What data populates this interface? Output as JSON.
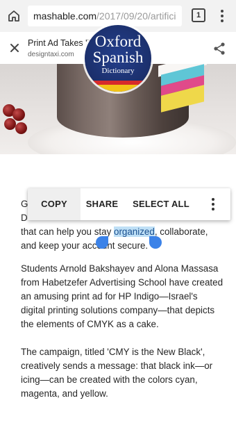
{
  "browser": {
    "url_host": "mashable.com",
    "url_path": "/2017/09/20/artifici",
    "tab_count": "1"
  },
  "custom_tab": {
    "title": "Print Ad Takes 'T",
    "domain": "designtaxi.com"
  },
  "oxford_badge": {
    "line1": "Oxford",
    "line2": "Spanish",
    "line3": "Dictionary"
  },
  "article": {
    "para1_partial_start": "G",
    "para1_partial_line2": "D",
    "para1_line3_before": "that can help you stay ",
    "para1_selected": "organized",
    "para1_line3_after": ", collaborate,",
    "para1_line4": "and keep your account secure.",
    "para2": "Students Arnold Bakshayev and Alona Massasa from Habetzefer Advertising School have created an amusing print ad for HP Indigo—Israel's digital printing solutions company—that depicts the elements of CMYK as a cake.",
    "para3": "The campaign, titled 'CMY is the New Black', creatively sends a message: that black ink—or icing—can be created with the colors cyan, magenta, and yellow."
  },
  "action_mode": {
    "copy_label": "COPY",
    "share_label": "SHARE",
    "select_all_label": "SELECT ALL"
  },
  "colors": {
    "selection_highlight": "#bfe0f6",
    "handle": "#3b82e8",
    "oxford_blue": "#1b2f6b"
  }
}
